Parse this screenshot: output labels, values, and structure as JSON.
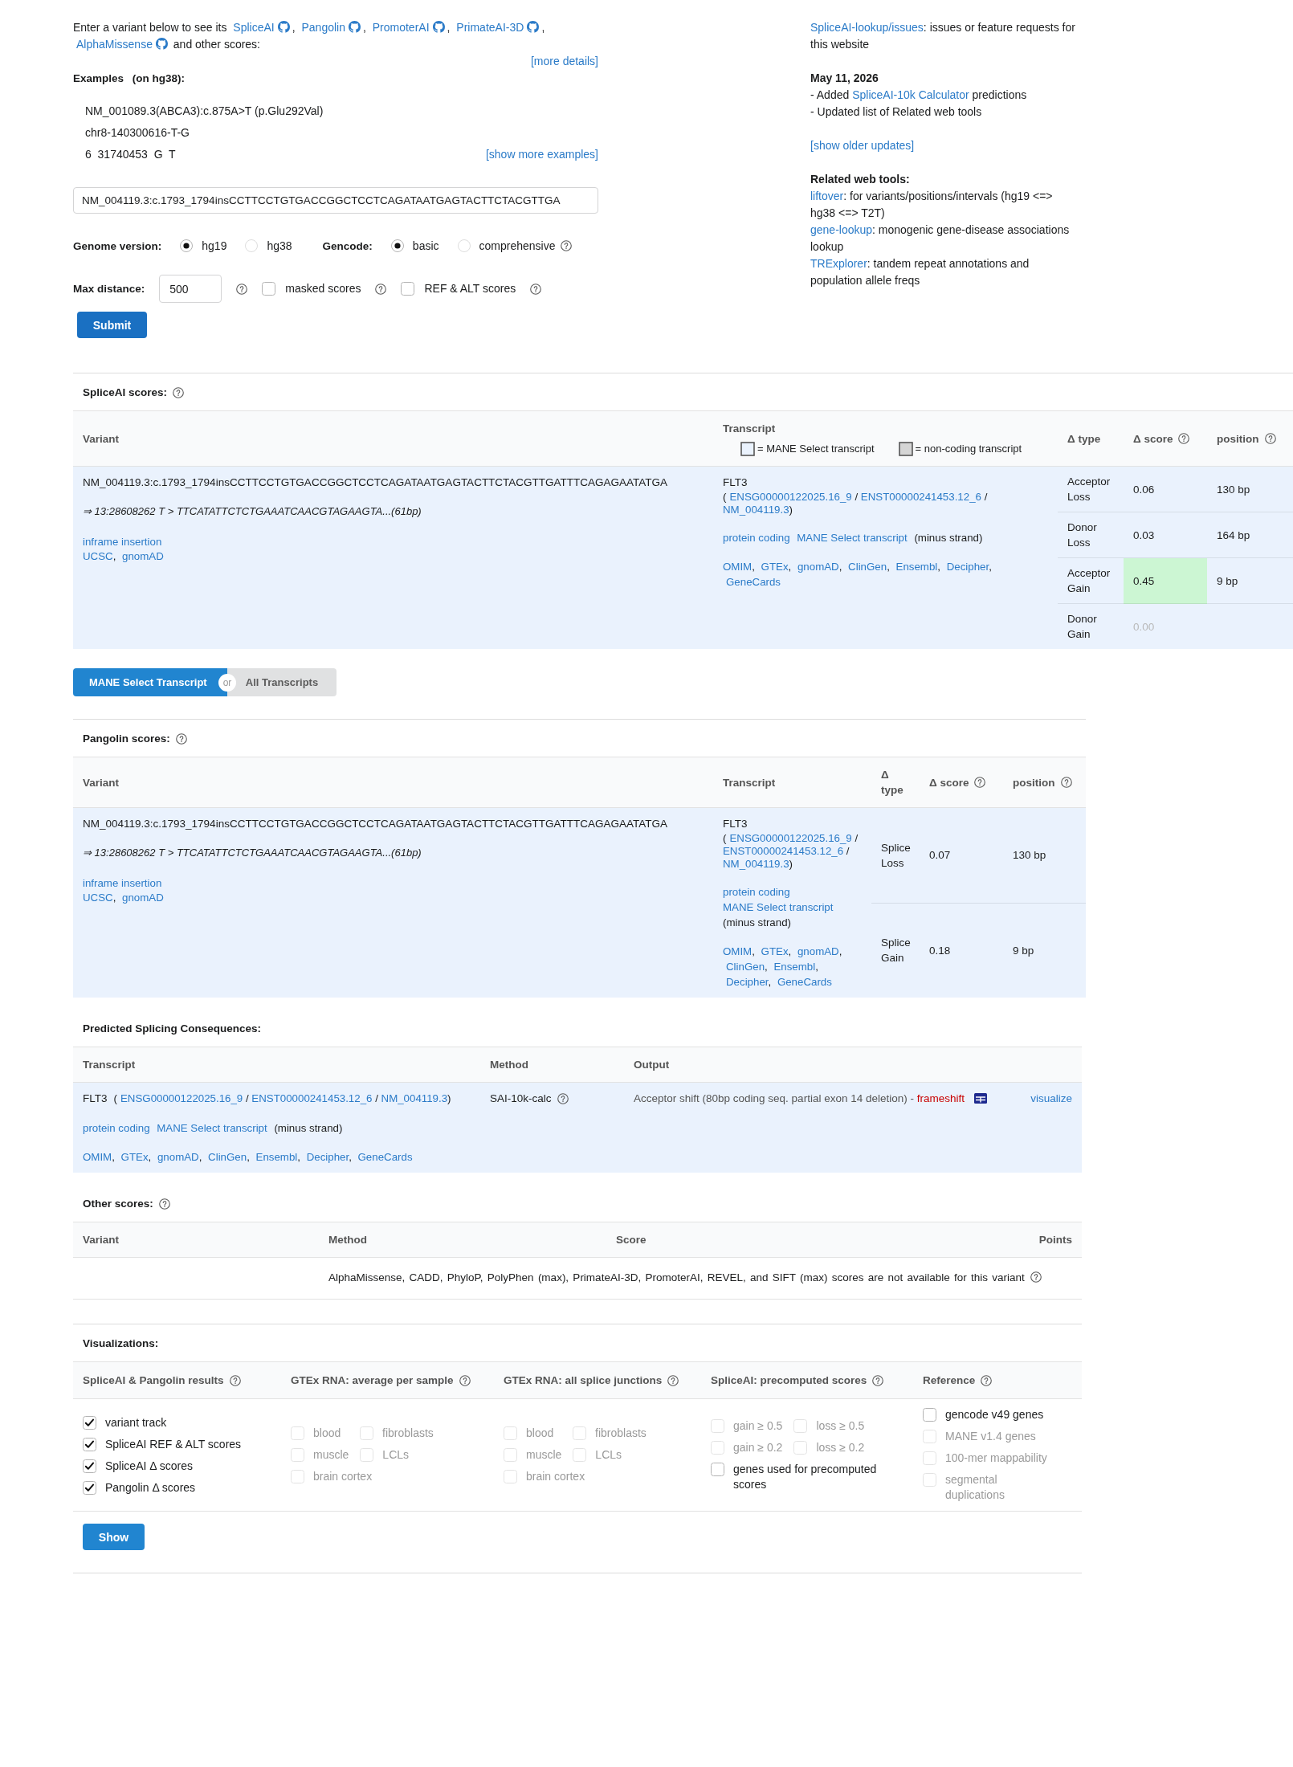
{
  "intro": {
    "lead": "Enter a variant below to see its",
    "tools": [
      "SpliceAI",
      "Pangolin",
      "PromoterAI",
      "PrimateAI-3D",
      "AlphaMissense"
    ],
    "separator": ",",
    "tail": "and other scores:",
    "more_link": "[more details]"
  },
  "examples": {
    "title": "Examples",
    "note": "(on hg38):",
    "items": [
      "NM_001089.3(ABCA3):c.875A>T (p.Glu292Val)",
      "chr8-140300616-T-G",
      "6  31740453  G  T"
    ],
    "more_link": "[show more examples]"
  },
  "form": {
    "variant_value": "NM_004119.3:c.1793_1794insCCTTCCTGTGACCGGCTCCTCAGATAATGAGTACTTCTACGTTGA",
    "genome": {
      "label": "Genome version:",
      "options": [
        {
          "label": "hg19",
          "selected": true
        },
        {
          "label": "hg38",
          "selected": false
        }
      ]
    },
    "gencode": {
      "label": "Gencode:",
      "options": [
        {
          "label": "basic",
          "selected": true
        },
        {
          "label": "comprehensive",
          "selected": false
        }
      ],
      "help": true
    },
    "max_distance": {
      "label": "Max distance:",
      "value": "500",
      "help": true
    },
    "toggles": [
      {
        "label": "masked scores",
        "checked": false,
        "help": true
      },
      {
        "label": "REF & ALT scores",
        "checked": false,
        "help": true
      }
    ],
    "submit": "Submit"
  },
  "news": {
    "issues": {
      "link": "SpliceAI-lookup/issues",
      "after": ": issues or feature requests for this website"
    },
    "date": "May 11, 2026",
    "updates": [
      {
        "before": "- Added ",
        "link": "SpliceAI-10k Calculator",
        "after": " predictions"
      },
      {
        "before": "- Updated list of Related web tools"
      }
    ],
    "older_link": "[show older updates]",
    "tools_title": "Related web tools:",
    "tools": [
      {
        "link": "liftover",
        "after": ": for variants/positions/intervals (hg19 <=> hg38 <=> T2T)"
      },
      {
        "link": "gene-lookup",
        "after": ": monogenic gene-disease associations lookup"
      },
      {
        "link": "TRExplorer",
        "after": ": tandem repeat annotations and population allele freqs"
      }
    ]
  },
  "spliceai": {
    "title": "SpliceAI scores:",
    "help": true,
    "columns": [
      {
        "label": "Variant",
        "help": false
      },
      {
        "label": "Transcript",
        "help": false
      },
      {
        "label": "Δ type",
        "help": false
      },
      {
        "label": "Δ score",
        "help": true
      },
      {
        "label": "position",
        "help": true
      }
    ],
    "legend": [
      {
        "label": "= MANE Select transcript",
        "color": "#eaf2fd"
      },
      {
        "label": "= non-coding transcript",
        "color": "#d5d5d5"
      }
    ],
    "variant": {
      "name": "NM_004119.3:c.1793_1794insCCTTCCTGTGACCGGCTCCTCAGATAATGAGTACTTCTACGTTGATTTCAGAGAATATGA",
      "mapping": "⇒ 13:28608262 T > TTCATATTCTCTGAAATCAACGTAGAAGTA...(61bp)",
      "consequence": "inframe insertion",
      "links": [
        "UCSC",
        "gnomAD"
      ],
      "separator": ","
    },
    "transcript": {
      "gene": "FLT3",
      "open": "(",
      "ids": [
        "ENSG00000122025.16_9",
        "ENST00000241453.12_6",
        "NM_004119.3"
      ],
      "id_separator": "/",
      "close": ")",
      "tags": [
        "protein coding",
        "MANE Select transcript"
      ],
      "strand": "(minus strand)",
      "links": [
        "OMIM",
        "GTEx",
        "gnomAD",
        "ClinGen",
        "Ensembl",
        "Decipher",
        "GeneCards"
      ],
      "separator": ","
    },
    "rows": [
      {
        "type": "Acceptor Loss",
        "score": "0.06",
        "position": "130 bp",
        "highlight": false,
        "muted": false
      },
      {
        "type": "Donor Loss",
        "score": "0.03",
        "position": "164 bp",
        "highlight": false,
        "muted": false
      },
      {
        "type": "Acceptor Gain",
        "score": "0.45",
        "position": "9 bp",
        "highlight": true,
        "muted": false
      },
      {
        "type": "Donor Gain",
        "score": "0.00",
        "highlight": false,
        "muted": true
      }
    ]
  },
  "toggle": {
    "options": [
      {
        "label": "MANE Select Transcript",
        "selected": true
      },
      {
        "label": "All Transcripts",
        "selected": false
      }
    ],
    "or": "or"
  },
  "pangolin": {
    "title": "Pangolin scores:",
    "help": true,
    "columns": [
      {
        "label": "Variant",
        "help": false
      },
      {
        "label": "Transcript",
        "help": false
      },
      {
        "label": "Δ type",
        "help": false
      },
      {
        "label": "Δ score",
        "help": true
      },
      {
        "label": "position",
        "help": true
      }
    ],
    "variant": {
      "name": "NM_004119.3:c.1793_1794insCCTTCCTGTGACCGGCTCCTCAGATAATGAGTACTTCTACGTTGATTTCAGAGAATATGA",
      "mapping": "⇒ 13:28608262 T > TTCATATTCTCTGAAATCAACGTAGAAGTA...(61bp)",
      "consequence": "inframe insertion",
      "links": [
        "UCSC",
        "gnomAD"
      ],
      "separator": ","
    },
    "transcript": {
      "gene": "FLT3",
      "open": "(",
      "ids": [
        "ENSG00000122025.16_9",
        "ENST00000241453.12_6",
        "NM_004119.3"
      ],
      "id_separator": "/",
      "close": ")",
      "tags": [
        "protein coding",
        "MANE Select transcript"
      ],
      "strand": "(minus strand)",
      "links": [
        "OMIM",
        "GTEx",
        "gnomAD",
        "ClinGen",
        "Ensembl",
        "Decipher",
        "GeneCards"
      ],
      "separator": ","
    },
    "rows": [
      {
        "type": "Splice Loss",
        "score": "0.07",
        "position": "130 bp",
        "highlight": false,
        "muted": false
      },
      {
        "type": "Splice Gain",
        "score": "0.18",
        "position": "9 bp",
        "highlight": false,
        "muted": false
      }
    ]
  },
  "consequences": {
    "title": "Predicted Splicing Consequences:",
    "columns": [
      {
        "label": "Transcript",
        "help": false
      },
      {
        "label": "Method",
        "help": false
      },
      {
        "label": "Output",
        "help": false
      }
    ],
    "transcript": {
      "gene": "FLT3",
      "open": "(",
      "ids": [
        "ENSG00000122025.16_9",
        "ENST00000241453.12_6",
        "NM_004119.3"
      ],
      "id_separator": "/",
      "close": ")",
      "tags": [
        "protein coding",
        "MANE Select transcript"
      ],
      "strand": "(minus strand)",
      "links": [
        "OMIM",
        "GTEx",
        "gnomAD",
        "ClinGen",
        "Ensembl",
        "Decipher",
        "GeneCards"
      ],
      "separator": ","
    },
    "method": {
      "label": "SAI-10k-calc",
      "help": true
    },
    "output": {
      "text": "Acceptor shift (80bp coding seq. partial exon 14 deletion) -",
      "effect": "frameshift",
      "link": "visualize"
    }
  },
  "other_scores": {
    "title": "Other scores:",
    "help": true,
    "columns": [
      {
        "label": "Variant",
        "help": false
      },
      {
        "label": "Method",
        "help": false
      },
      {
        "label": "Score",
        "help": false
      },
      {
        "label": "Points",
        "help": false
      }
    ],
    "message": "AlphaMissense, CADD, PhyloP, PolyPhen (max), PrimateAI-3D, PromoterAI, REVEL, and SIFT (max) scores are not available for this variant",
    "message_help": true
  },
  "visualizations": {
    "title": "Visualizations:",
    "columns": [
      {
        "label": "SpliceAI & Pangolin results",
        "help": true,
        "options": [
          {
            "label": "variant track",
            "checked": true,
            "disabled": false
          },
          {
            "label": "SpliceAI REF & ALT scores",
            "checked": true,
            "disabled": false
          },
          {
            "label": "SpliceAI Δ scores",
            "checked": true,
            "disabled": false
          },
          {
            "label": "Pangolin Δ scores",
            "checked": true,
            "disabled": false
          }
        ]
      },
      {
        "label": "GTEx RNA: average per sample",
        "help": true,
        "options": [
          {
            "label": "blood",
            "checked": false,
            "disabled": true
          },
          {
            "label": "fibroblasts",
            "checked": false,
            "disabled": true
          },
          {
            "label": "muscle",
            "checked": false,
            "disabled": true
          },
          {
            "label": "LCLs",
            "checked": false,
            "disabled": true
          },
          {
            "label": "brain cortex",
            "checked": false,
            "disabled": true
          }
        ]
      },
      {
        "label": "GTEx RNA: all splice junctions",
        "help": true,
        "options": [
          {
            "label": "blood",
            "checked": false,
            "disabled": true
          },
          {
            "label": "fibroblasts",
            "checked": false,
            "disabled": true
          },
          {
            "label": "muscle",
            "checked": false,
            "disabled": true
          },
          {
            "label": "LCLs",
            "checked": false,
            "disabled": true
          },
          {
            "label": "brain cortex",
            "checked": false,
            "disabled": true
          }
        ]
      },
      {
        "label": "SpliceAI: precomputed scores",
        "help": true,
        "options": [
          {
            "label": "gain ≥ 0.5",
            "checked": false,
            "disabled": true
          },
          {
            "label": "loss ≥ 0.5",
            "checked": false,
            "disabled": true
          },
          {
            "label": "gain ≥ 0.2",
            "checked": false,
            "disabled": true
          },
          {
            "label": "loss ≥ 0.2",
            "checked": false,
            "disabled": true
          },
          {
            "label": "genes used for precomputed scores",
            "checked": false,
            "disabled": false
          }
        ]
      },
      {
        "label": "Reference",
        "help": true,
        "options": [
          {
            "label": "gencode v49 genes",
            "checked": false,
            "disabled": false
          },
          {
            "label": "MANE v1.4 genes",
            "checked": false,
            "disabled": true
          },
          {
            "label": "100-mer mappability",
            "checked": false,
            "disabled": true
          },
          {
            "label": "segmental duplications",
            "checked": false,
            "disabled": true
          }
        ]
      }
    ],
    "show": "Show"
  }
}
